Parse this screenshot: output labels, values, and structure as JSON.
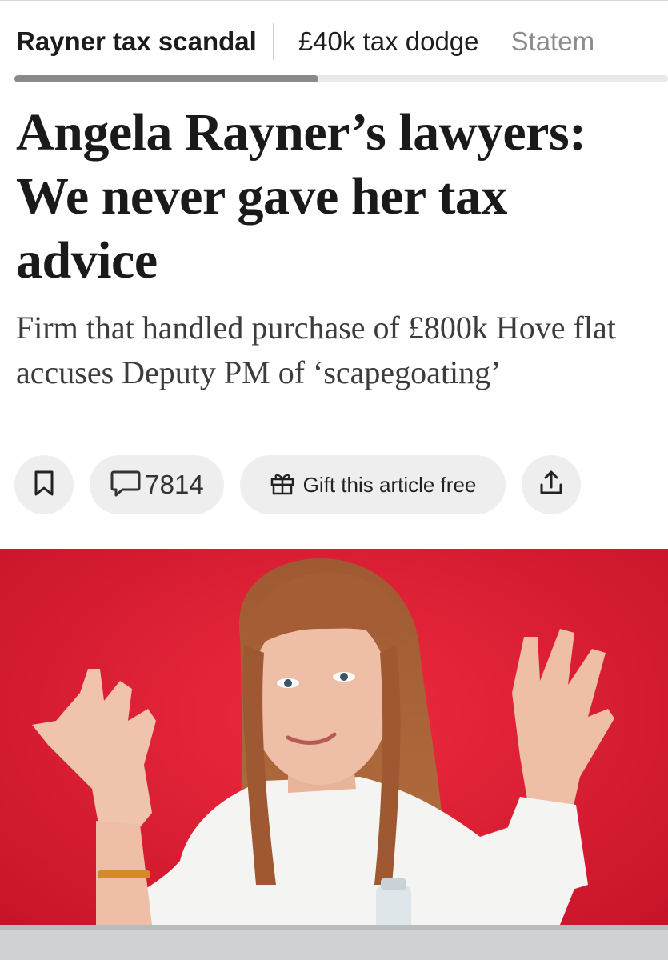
{
  "topic_nav": {
    "tabs": [
      {
        "label": "Rayner tax scandal",
        "active": true
      },
      {
        "label": "£40k tax dodge",
        "active": false
      },
      {
        "label": "Statem",
        "active": false
      }
    ]
  },
  "article": {
    "headline": "Angela Rayner’s lawyers: We never gave her tax advice",
    "standfirst": "Firm that handled purchase of £800k Hove flat accuses Deputy PM of ‘scapegoating’"
  },
  "actions": {
    "bookmark_icon": "bookmark-icon",
    "comment_icon": "speech-bubble-icon",
    "comment_count": "7814",
    "gift_icon": "gift-icon",
    "gift_label": "Gift this article free",
    "share_icon": "share-icon"
  },
  "hero_image": {
    "background_color": "#e01d34"
  },
  "colors": {
    "pill_background": "#eeeeee",
    "active_tab": "#1c1c1c",
    "inactive_tab": "#8d8d8d"
  }
}
